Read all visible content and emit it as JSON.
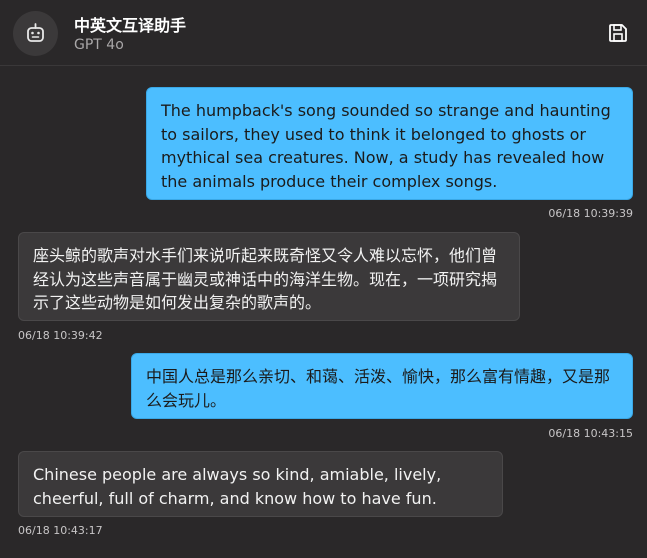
{
  "header": {
    "title": "中英文互译助手",
    "subtitle": "GPT 4o",
    "avatar_icon": "robot-icon",
    "save_icon": "save-icon"
  },
  "messages": [
    {
      "role": "user",
      "text": "The humpback's song sounded so strange and haunting to sailors, they used to think it belonged to ghosts or mythical sea creatures. Now, a study has revealed how the animals produce their complex songs.",
      "time": "06/18 10:39:39"
    },
    {
      "role": "assistant",
      "text": "座头鲸的歌声对水手们来说听起来既奇怪又令人难以忘怀，他们曾经认为这些声音属于幽灵或神话中的海洋生物。现在，一项研究揭示了这些动物是如何发出复杂的歌声的。",
      "time": "06/18 10:39:42"
    },
    {
      "role": "user",
      "text": "中国人总是那么亲切、和蔼、活泼、愉快，那么富有情趣，又是那么会玩儿。",
      "time": "06/18 10:43:15"
    },
    {
      "role": "assistant",
      "text": "Chinese people are always so kind, amiable, lively, cheerful, full of charm, and know how to have fun.",
      "time": "06/18 10:43:17"
    }
  ],
  "colors": {
    "background": "#2a2829",
    "user_bubble": "#4cbeff",
    "bot_bubble": "#3b393a"
  }
}
